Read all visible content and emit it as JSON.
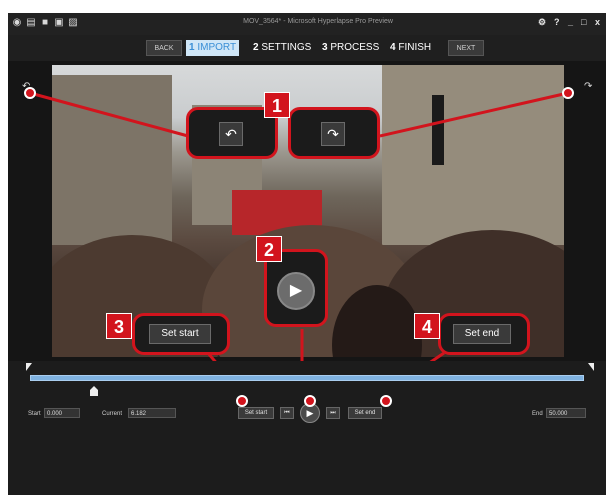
{
  "window": {
    "title": "MOV_3564* - Microsoft Hyperlapse Pro Preview",
    "controls": {
      "settings": "⚙",
      "help": "?",
      "minimize": "_",
      "maximize": "□",
      "close": "x"
    }
  },
  "wizard": {
    "back_label": "BACK",
    "next_label": "NEXT",
    "steps": [
      {
        "num": "1",
        "label": "IMPORT"
      },
      {
        "num": "2",
        "label": "SETTINGS"
      },
      {
        "num": "3",
        "label": "PROCESS"
      },
      {
        "num": "4",
        "label": "FINISH"
      }
    ]
  },
  "callouts": {
    "badge1": "1",
    "badge2": "2",
    "badge3": "3",
    "badge4": "4",
    "set_start_label": "Set start",
    "set_end_label": "Set end"
  },
  "timeline": {
    "start_label": "Start",
    "start_value": "0.000",
    "current_label": "Current",
    "current_value": "6.182",
    "end_label": "End",
    "end_value": "50.000",
    "set_start_button": "Set start",
    "set_end_button": "Set end"
  },
  "colors": {
    "accent": "#d2141d",
    "track": "#7fb2e0",
    "active_step_bg": "#cfe6f7"
  }
}
